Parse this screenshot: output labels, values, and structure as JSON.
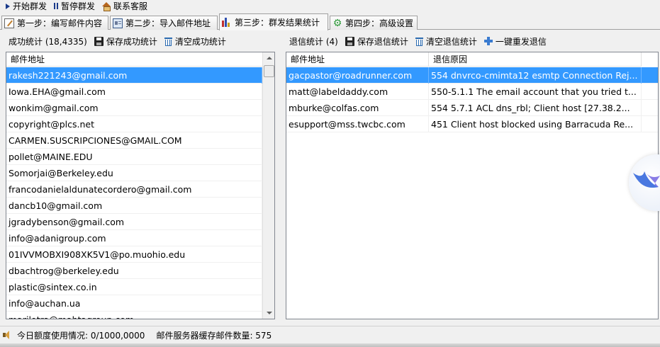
{
  "toolbar": {
    "start": "开始群发",
    "pause": "暂停群发",
    "contact": "联系客服"
  },
  "tabs": [
    {
      "label": "第一步：编写邮件内容",
      "icon": "edit-icon"
    },
    {
      "label": "第二步：导入邮件地址",
      "icon": "address-card-icon"
    },
    {
      "label": "第三步：群发结果统计",
      "icon": "bar-chart-icon",
      "active": true
    },
    {
      "label": "第四步：高级设置",
      "icon": "gear-icon"
    }
  ],
  "success": {
    "summary": "成功统计 (18,4335)",
    "save_label": "保存成功统计",
    "clear_label": "清空成功统计",
    "column": "邮件地址",
    "emails": [
      "rakesh221243@gmail.com",
      "Iowa.EHA@gmail.com",
      "wonkim@gmail.com",
      "copyright@plcs.net",
      "CARMEN.SUSCRIPCIONES@GMAIL.COM",
      "pollet@MAINE.EDU",
      "Somorjai@Berkeley.edu",
      "francodanielaldunatecordero@gmail.com",
      "dancb10@gmail.com",
      "jgradybenson@gmail.com",
      "info@adanigroup.com",
      "01IVVMOBXI908XK5V1@po.muohio.edu",
      "dbachtrog@berkeley.edu",
      "plastic@sintex.co.in",
      "info@auchan.ua",
      "marilotra@mahtagroup.com"
    ]
  },
  "bounce": {
    "summary": "退信统计 (4)",
    "save_label": "保存退信统计",
    "clear_label": "清空退信统计",
    "resend_label": "一键重发退信",
    "columns": [
      "邮件地址",
      "退信原因"
    ],
    "rows": [
      {
        "email": "gacpastor@roadrunner.com",
        "reason": "554 dnvrco-cmimta12 esmtp Connection Rej..."
      },
      {
        "email": "matt@labeldaddy.com",
        "reason": "550-5.1.1 The email account that you tried t..."
      },
      {
        "email": "mburke@colfas.com",
        "reason": "554 5.7.1 ACL dns_rbl; Client host [27.38.2..."
      },
      {
        "email": "esupport@mss.twcbc.com",
        "reason": "451 Client host blocked using Barracuda Re..."
      }
    ]
  },
  "status": {
    "quota": "今日额度使用情况: 0/1000,0000",
    "cache": "邮件服务器缓存邮件数量: 575"
  },
  "colors": {
    "selection": "#3399ff",
    "accent": "#1a3a8a"
  }
}
